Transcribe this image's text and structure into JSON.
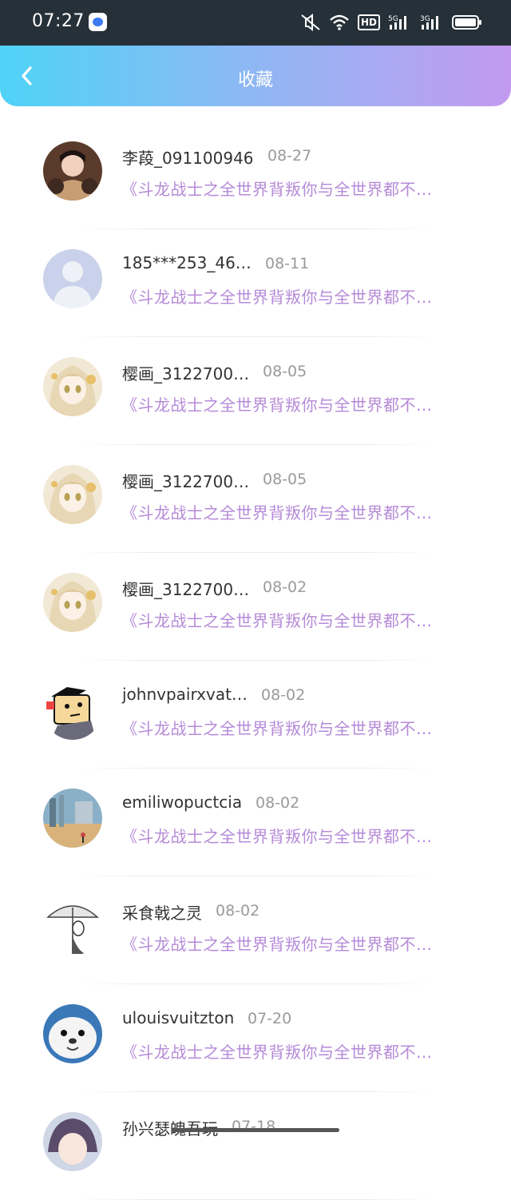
{
  "status_bar": {
    "time": "07:27",
    "hd_label": "HD",
    "network_5g": "5G",
    "network_3g": "3G"
  },
  "header": {
    "title": "收藏",
    "back_icon": "chevron-left-icon",
    "gradient": [
      "#4fd3f7",
      "#c39af0"
    ]
  },
  "colors": {
    "accent_text": "#b58ad8",
    "name_text": "#333333",
    "date_text": "#9a9a9a"
  },
  "favorites": [
    {
      "name": "李葮_091100946",
      "date": "08-27",
      "book": "《斗龙战士之全世界背叛你与全世界都不…",
      "avatar": "photo-girl"
    },
    {
      "name": "185***253_46…",
      "date": "08-11",
      "book": "《斗龙战士之全世界背叛你与全世界都不…",
      "avatar": "default-user"
    },
    {
      "name": "樱画_3122700…",
      "date": "08-05",
      "book": "《斗龙战士之全世界背叛你与全世界都不…",
      "avatar": "anime-girl"
    },
    {
      "name": "樱画_3122700…",
      "date": "08-05",
      "book": "《斗龙战士之全世界背叛你与全世界都不…",
      "avatar": "anime-girl"
    },
    {
      "name": "樱画_3122700…",
      "date": "08-02",
      "book": "《斗龙战士之全世界背叛你与全世界都不…",
      "avatar": "anime-girl"
    },
    {
      "name": "johnvpairxvat…",
      "date": "08-02",
      "book": "《斗龙战士之全世界背叛你与全世界都不…",
      "avatar": "cartoon-face"
    },
    {
      "name": "emiliwopuctcia",
      "date": "08-02",
      "book": "《斗龙战士之全世界背叛你与全世界都不…",
      "avatar": "scenery"
    },
    {
      "name": "采食戟之灵",
      "date": "08-02",
      "book": "《斗龙战士之全世界背叛你与全世界都不…",
      "avatar": "umbrella-sketch"
    },
    {
      "name": "ulouisvuitzton",
      "date": "07-20",
      "book": "《斗龙战士之全世界背叛你与全世界都不…",
      "avatar": "seal"
    },
    {
      "name": "孙兴瑟魄吾玩",
      "date": "07-18",
      "book": "",
      "avatar": "anime-boy"
    }
  ]
}
